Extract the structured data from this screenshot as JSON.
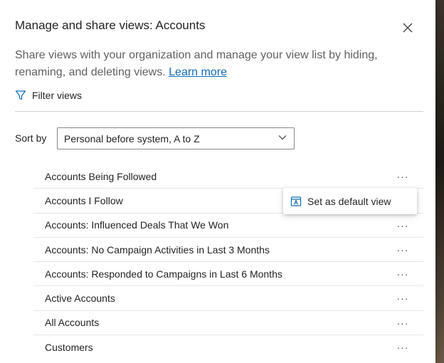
{
  "panel": {
    "title": "Manage and share views: Accounts",
    "description": "Share views with your organization and manage your view list by hiding, renaming, and deleting views.",
    "learn_more": "Learn more",
    "filter_label": "Filter views"
  },
  "sort": {
    "label": "Sort by",
    "selected": "Personal before system, A to Z"
  },
  "views": [
    {
      "label": "Accounts Being Followed"
    },
    {
      "label": "Accounts I Follow"
    },
    {
      "label": "Accounts: Influenced Deals That We Won"
    },
    {
      "label": "Accounts: No Campaign Activities in Last 3 Months"
    },
    {
      "label": "Accounts: Responded to Campaigns in Last 6 Months"
    },
    {
      "label": "Active Accounts"
    },
    {
      "label": "All Accounts"
    },
    {
      "label": "Customers"
    }
  ],
  "more_glyph": "···",
  "context_menu": {
    "item": "Set as default view"
  },
  "colors": {
    "link": "#0f6cbd",
    "text": "#242424",
    "secondary_text": "#616161"
  }
}
